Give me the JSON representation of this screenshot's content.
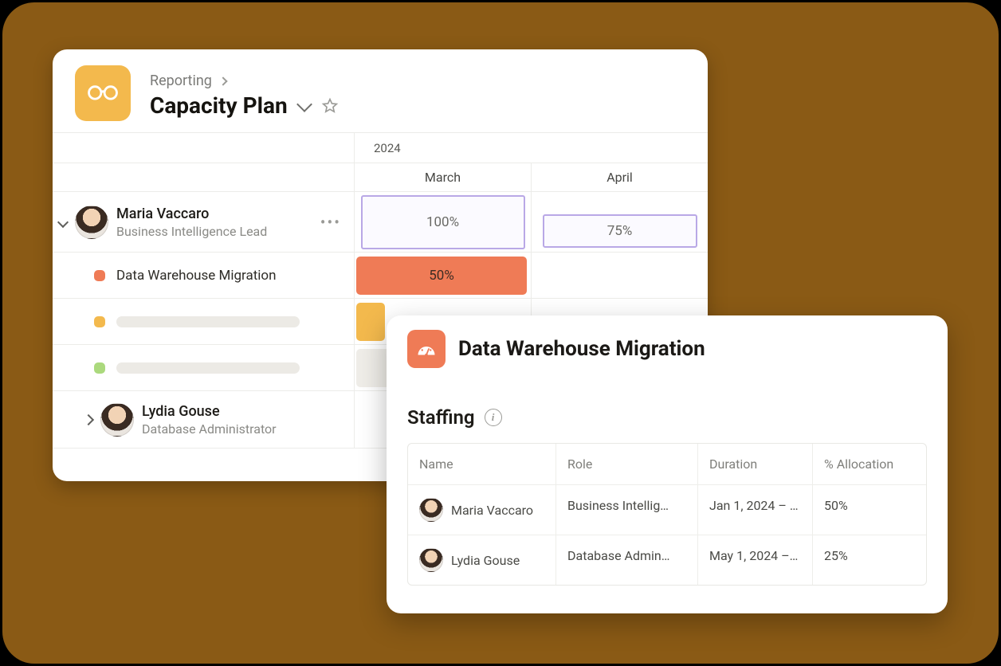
{
  "colors": {
    "accent_yellow": "#f3b94d",
    "accent_orange": "#ef7b56",
    "accent_green": "#abd97d",
    "alloc_border": "#b9a8e6"
  },
  "breadcrumb": {
    "parent": "Reporting"
  },
  "page": {
    "title": "Capacity Plan"
  },
  "timeline": {
    "year": "2024",
    "months": [
      "March",
      "April"
    ]
  },
  "people": [
    {
      "name": "Maria Vaccaro",
      "role": "Business Intelligence Lead",
      "expanded": true,
      "allocations": {
        "march": "100%",
        "april": "75%"
      },
      "tasks": [
        {
          "name": "Data Warehouse Migration",
          "color": "orange",
          "march": "50%"
        },
        {
          "name": "",
          "color": "yellow",
          "placeholder": true
        },
        {
          "name": "",
          "color": "green",
          "placeholder": true
        }
      ]
    },
    {
      "name": "Lydia Gouse",
      "role": "Database Administrator",
      "expanded": false
    }
  ],
  "project_popover": {
    "title": "Data Warehouse Migration",
    "section_label": "Staffing",
    "columns": [
      "Name",
      "Role",
      "Duration",
      "% Allocation"
    ],
    "rows": [
      {
        "name": "Maria Vaccaro",
        "role": "Business Intellig…",
        "duration": "Jan 1, 2024 – …",
        "allocation": "50%"
      },
      {
        "name": "Lydia Gouse",
        "role": "Database Admin…",
        "duration": "May 1, 2024 – …",
        "allocation": "25%"
      }
    ]
  }
}
